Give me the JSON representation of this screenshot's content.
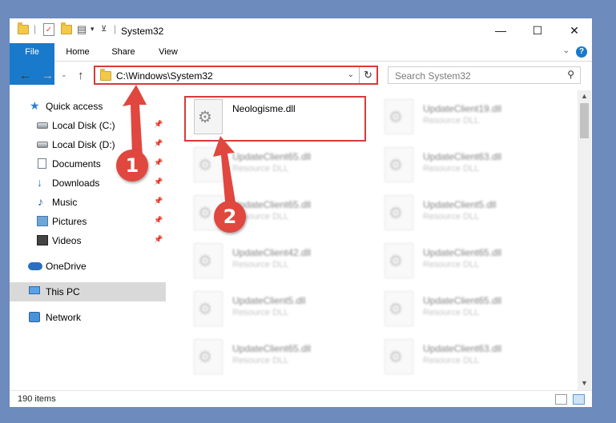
{
  "window": {
    "title": "System32",
    "controls": {
      "minimize": "—",
      "maximize": "☐",
      "close": "✕"
    }
  },
  "ribbon": {
    "tabs": [
      "File",
      "Home",
      "Share",
      "View"
    ],
    "help": "?"
  },
  "navigation": {
    "address": "C:\\Windows\\System32",
    "search_placeholder": "Search System32"
  },
  "nav_pane": {
    "items": [
      {
        "label": "Quick access",
        "icon": "star-icon",
        "pinned": false
      },
      {
        "label": "Local Disk (C:)",
        "icon": "drive-icon",
        "pinned": true
      },
      {
        "label": "Local Disk (D:)",
        "icon": "drive-icon",
        "pinned": true
      },
      {
        "label": "Documents",
        "icon": "documents-icon",
        "pinned": true
      },
      {
        "label": "Downloads",
        "icon": "downloads-icon",
        "pinned": true
      },
      {
        "label": "Music",
        "icon": "music-icon",
        "pinned": true
      },
      {
        "label": "Pictures",
        "icon": "pictures-icon",
        "pinned": true
      },
      {
        "label": "Videos",
        "icon": "videos-icon",
        "pinned": true
      },
      {
        "label": "OneDrive",
        "icon": "onedrive-icon",
        "pinned": false
      },
      {
        "label": "This PC",
        "icon": "this-pc-icon",
        "pinned": false,
        "selected": true
      },
      {
        "label": "Network",
        "icon": "network-icon",
        "pinned": false
      }
    ]
  },
  "files": [
    {
      "name": "Neologisme.dll",
      "type": "",
      "highlighted": true
    },
    {
      "name": "UpdateClient19.dll",
      "type": "Resource DLL"
    },
    {
      "name": "UpdateClient65.dll",
      "type": "Resource DLL"
    },
    {
      "name": "UpdateClient63.dll",
      "type": "Resource DLL"
    },
    {
      "name": "UpdateClient65.dll",
      "type": "Resource DLL"
    },
    {
      "name": "UpdateClient5.dll",
      "type": "Resource DLL"
    },
    {
      "name": "UpdateClient42.dll",
      "type": "Resource DLL"
    },
    {
      "name": "UpdateClient65.dll",
      "type": "Resource DLL"
    },
    {
      "name": "UpdateClient5.dll",
      "type": "Resource DLL"
    },
    {
      "name": "UpdateClient65.dll",
      "type": "Resource DLL"
    },
    {
      "name": "UpdateClient65.dll",
      "type": "Resource DLL"
    },
    {
      "name": "UpdateClient63.dll",
      "type": "Resource DLL"
    }
  ],
  "status": {
    "item_count": "190 items"
  },
  "callouts": {
    "step1": "1",
    "step2": "2"
  },
  "colors": {
    "accent": "#1979ca",
    "annotation_red": "#e0473f"
  }
}
